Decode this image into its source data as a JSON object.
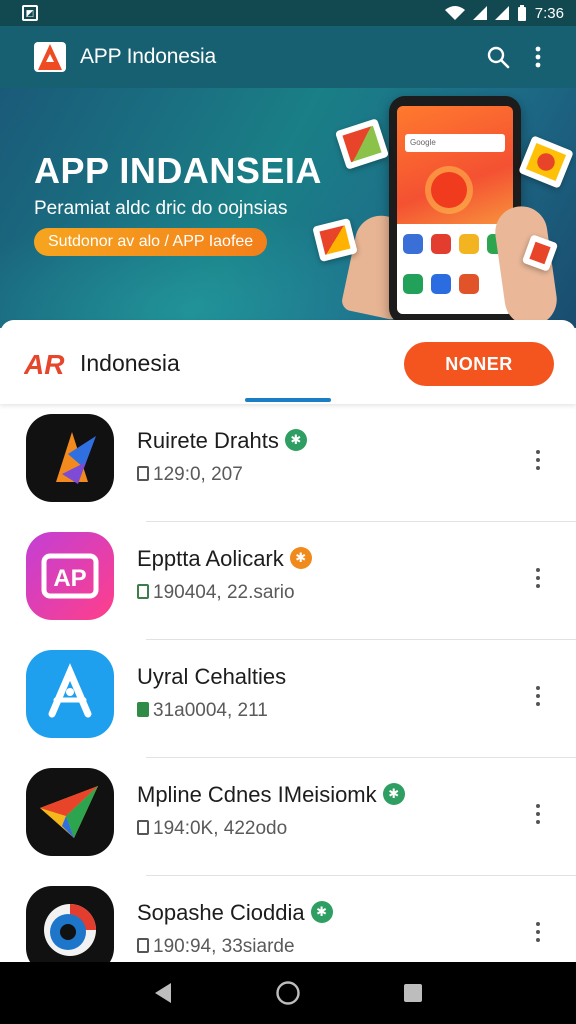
{
  "status_bar": {
    "time": "7:36"
  },
  "app_bar": {
    "title": "APP Indonesia"
  },
  "banner": {
    "headline": "APP INDANSEIA",
    "subline": "Peramiat aldc dric do oojnsias",
    "cta_label": "Sutdonor av alo / APP Iaofee",
    "phone_search_text": "Google"
  },
  "tabs": {
    "brand_mark": "AR",
    "title": "Indonesia",
    "action_label": "NONER"
  },
  "apps": [
    {
      "name": "Ruirete Drahts",
      "meta": "129:0, 207",
      "badge_color": "#2e9e62",
      "icon": "star-triangle-icon"
    },
    {
      "name": "Epptta Aolicark",
      "meta": "190404, 22.sario",
      "badge_color": "#f08a1c",
      "icon": "ap-logo-icon"
    },
    {
      "name": "Uyral Cehalties",
      "meta": "31a0004, 211",
      "badge_color": "",
      "icon": "a-star-icon"
    },
    {
      "name": "Mpline Cdnes IMeisiomk",
      "meta": "194:0K, 422odo",
      "badge_color": "#2e9e62",
      "icon": "paper-plane-icon"
    },
    {
      "name": "Sopashe Cioddia",
      "meta": "190:94, 33siarde",
      "badge_color": "#2e9e62",
      "icon": "eye-target-icon"
    }
  ],
  "colors": {
    "app_bar": "#176071",
    "accent_orange": "#f4541e",
    "tab_indicator": "#1a7fc2"
  }
}
